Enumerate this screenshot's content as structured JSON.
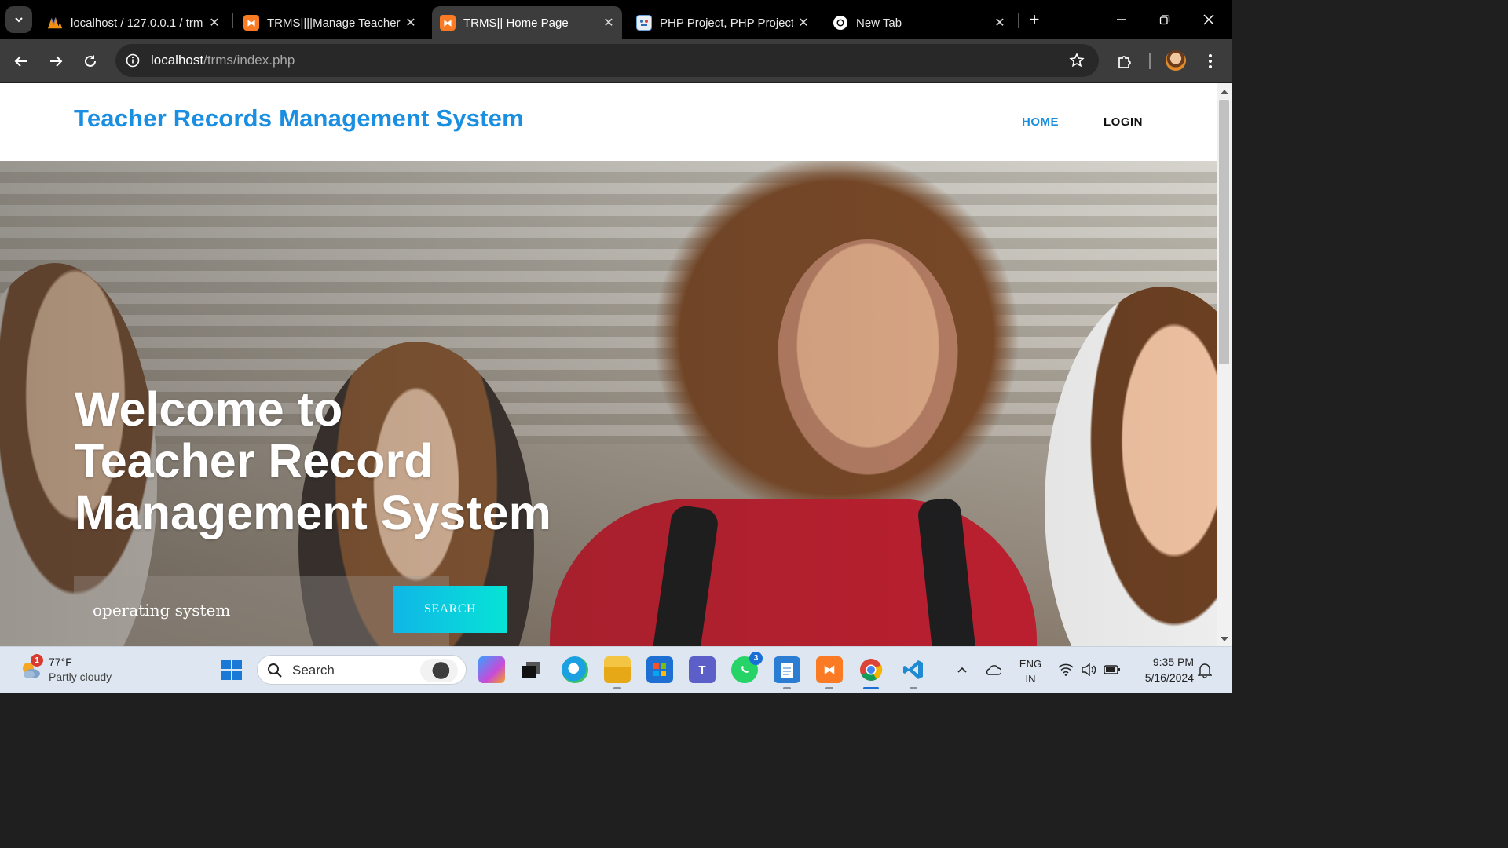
{
  "browser": {
    "tabs": [
      {
        "title": "localhost / 127.0.0.1 / trm",
        "favicon": "phpmyadmin-icon",
        "active": false
      },
      {
        "title": "TRMS||||Manage Teacher",
        "favicon": "xampp-icon",
        "active": false
      },
      {
        "title": "TRMS|| Home Page",
        "favicon": "xampp-icon",
        "active": true
      },
      {
        "title": "PHP Project, PHP Projects",
        "favicon": "site-icon",
        "active": false
      },
      {
        "title": "New Tab",
        "favicon": "chrome-icon",
        "active": false
      }
    ],
    "url_host": "localhost",
    "url_path": "/trms/index.php"
  },
  "site": {
    "brand": "Teacher Records Management System",
    "nav": {
      "home": "HOME",
      "login": "LOGIN"
    },
    "hero": {
      "line1": "Welcome to",
      "line2": "Teacher Record",
      "line3": "Management System"
    },
    "search": {
      "value": "operating system",
      "button": "SEARCH"
    }
  },
  "colors": {
    "brand": "#1a8ee0",
    "search_gradient_start": "#10b6e6",
    "search_gradient_end": "#07e3d6",
    "tab_active": "#3c3c3c"
  },
  "taskbar": {
    "weather": {
      "temp": "77°F",
      "condition": "Partly cloudy",
      "badge": "1"
    },
    "search_label": "Search",
    "whatsapp_badge": "3",
    "lang_top": "ENG",
    "lang_bottom": "IN",
    "time": "9:35 PM",
    "date": "5/16/2024"
  }
}
